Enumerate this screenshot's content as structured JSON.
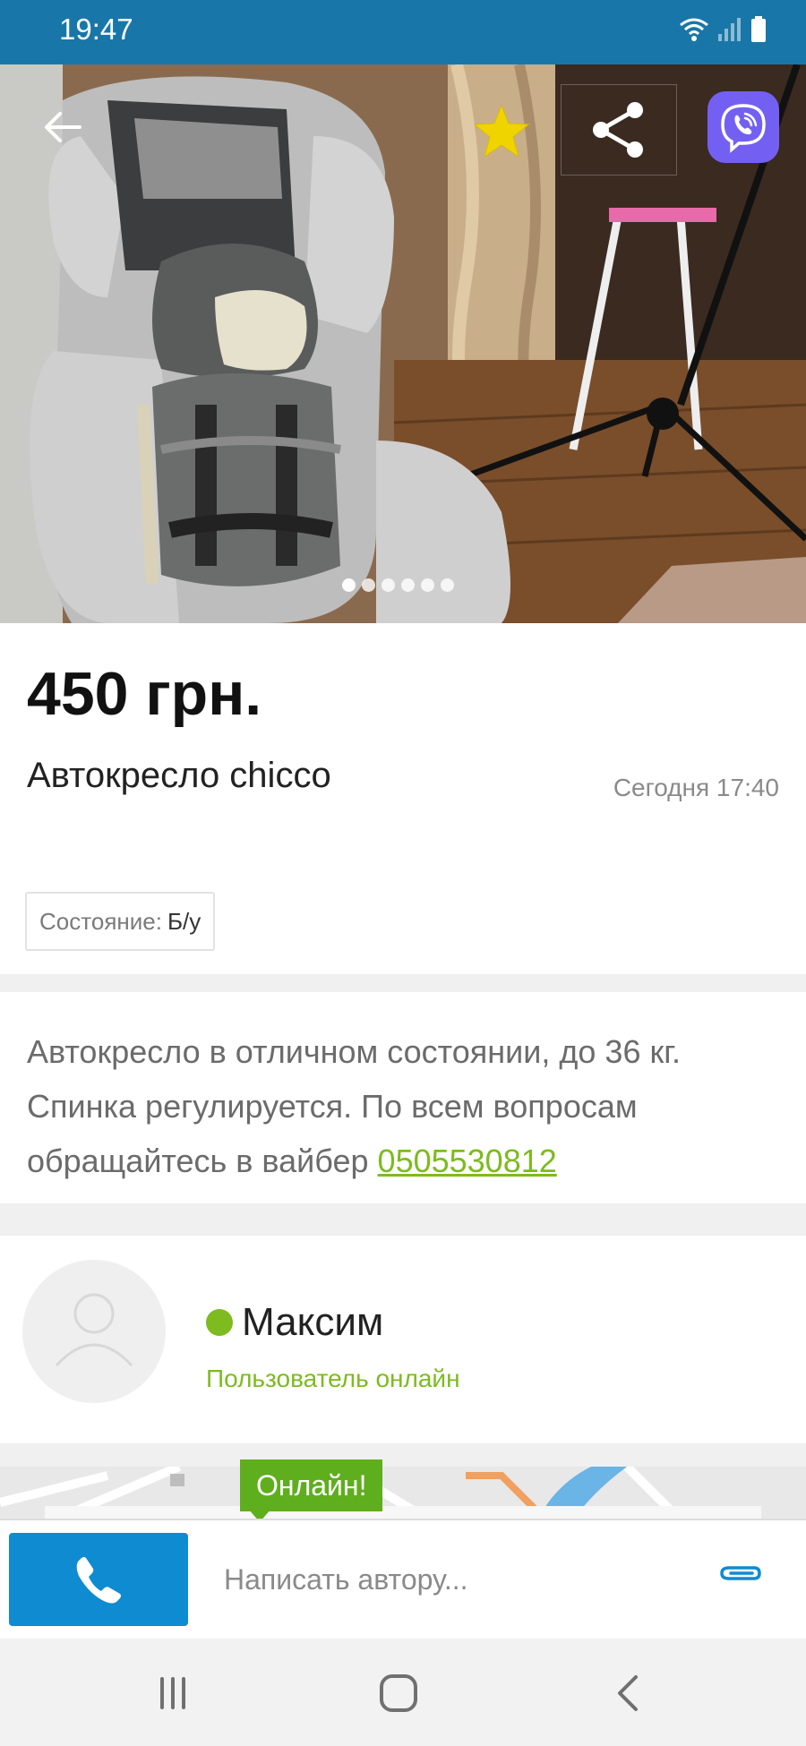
{
  "status_bar": {
    "time": "19:47"
  },
  "gallery": {
    "photo_count": 6,
    "active_index": 0
  },
  "listing": {
    "price": "450 грн.",
    "title": "Автокресло chicco",
    "date": "Сегодня 17:40",
    "condition_label": "Состояние:",
    "condition_value": "Б/у",
    "description_text": "Автокресло в отличном состоянии, до 36 кг. Спинка регулируется. По всем вопросам обращайтесь в вайбер ",
    "description_phone": "0505530812"
  },
  "seller": {
    "name": "Максим",
    "status": "Пользователь онлайн",
    "online_badge": "Онлайн!"
  },
  "message": {
    "placeholder": "Написать автору..."
  },
  "colors": {
    "status_bar": "#1877a8",
    "accent_green": "#7dbb1e",
    "call_button": "#0e8bd1",
    "viber_purple": "#7360f2"
  },
  "icons": [
    "back-arrow-icon",
    "favorite-star-icon",
    "share-icon",
    "viber-icon",
    "user-avatar-icon",
    "phone-icon",
    "paperclip-icon",
    "recent-apps-icon",
    "home-icon",
    "nav-back-icon"
  ]
}
